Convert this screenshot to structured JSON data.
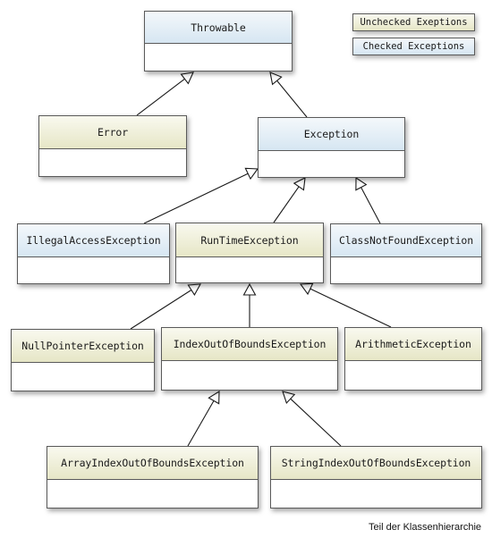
{
  "diagram": {
    "caption": "Teil der Klassenhierarchie",
    "legend": {
      "unchecked_label": "Unchecked Exeptions",
      "checked_label": "Checked Exceptions",
      "unchecked_color": "#e6e6c6",
      "checked_color": "#d6e6f2"
    },
    "classes": {
      "throwable": {
        "name": "Throwable",
        "kind": "checked"
      },
      "error": {
        "name": "Error",
        "kind": "unchecked"
      },
      "exception": {
        "name": "Exception",
        "kind": "checked"
      },
      "illegal_access": {
        "name": "IllegalAccessException",
        "kind": "checked"
      },
      "runtime": {
        "name": "RunTimeException",
        "kind": "unchecked"
      },
      "class_not_found": {
        "name": "ClassNotFoundException",
        "kind": "checked"
      },
      "null_pointer": {
        "name": "NullPointerException",
        "kind": "unchecked"
      },
      "index_out_of_bounds": {
        "name": "IndexOutOfBoundsException",
        "kind": "unchecked"
      },
      "arithmetic": {
        "name": "ArithmeticException",
        "kind": "unchecked"
      },
      "array_index": {
        "name": "ArrayIndexOutOfBoundsException",
        "kind": "unchecked"
      },
      "string_index": {
        "name": "StringIndexOutOfBoundsException",
        "kind": "unchecked"
      }
    },
    "inheritance": [
      {
        "child": "error",
        "parent": "throwable"
      },
      {
        "child": "exception",
        "parent": "throwable"
      },
      {
        "child": "illegal_access",
        "parent": "exception"
      },
      {
        "child": "runtime",
        "parent": "exception"
      },
      {
        "child": "class_not_found",
        "parent": "exception"
      },
      {
        "child": "null_pointer",
        "parent": "runtime"
      },
      {
        "child": "index_out_of_bounds",
        "parent": "runtime"
      },
      {
        "child": "arithmetic",
        "parent": "runtime"
      },
      {
        "child": "array_index",
        "parent": "index_out_of_bounds"
      },
      {
        "child": "string_index",
        "parent": "index_out_of_bounds"
      }
    ]
  }
}
